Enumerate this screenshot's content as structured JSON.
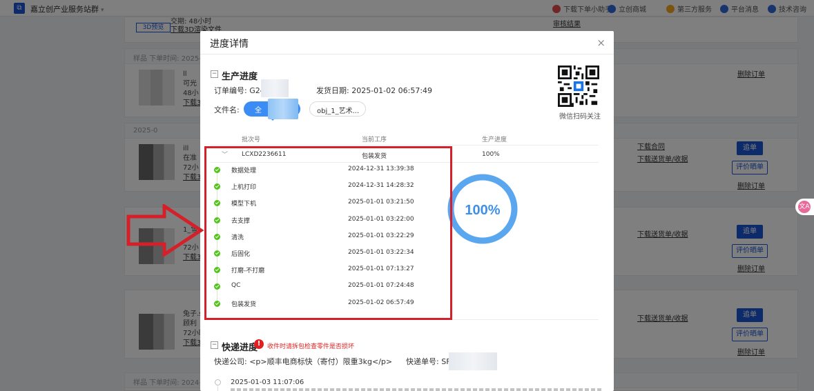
{
  "topbar": {
    "brand": "嘉立创产业服务站群",
    "nav": [
      {
        "label": "下载下单小助手",
        "color": "#e24a4a"
      },
      {
        "label": "立创商城",
        "color": "#2f6bd8"
      },
      {
        "label": "第三方服务",
        "color": "#f4a623"
      },
      {
        "label": "平台消息",
        "color": "#2f6bd8"
      },
      {
        "label": "技术咨询",
        "color": "#2f6bd8"
      }
    ]
  },
  "background": {
    "card0": {
      "time": "交期: 48小时",
      "dl": "下载3D渲染文件",
      "tag": "3D预览",
      "review": "审核结果"
    },
    "card1": {
      "head": "样品    下单时间: 2025-0",
      "t1": "ll",
      "t2": "可光",
      "t3": "48小",
      "dl": "下载3D",
      "del": "删除订单"
    },
    "card2": {
      "head": "2025-0",
      "t1": "ill",
      "t2": "在准",
      "t3": "72小",
      "dl": "下载3D",
      "link1": "下载合同",
      "link2": "下载送货单/收据",
      "btn1": "追单",
      "btn2": "评价晒单",
      "del": "删除订单"
    },
    "card3": {
      "t1": "1_雪",
      "t3": "72小",
      "dl": "下载3D",
      "link2": "下载送货单/收据",
      "btn1": "追单",
      "btn2": "评价晒单",
      "del": "删除订单"
    },
    "card4": {
      "t1": "兔子.s",
      "t2": "顾利",
      "t3": "72小时",
      "dl": "下载3D",
      "link2": "下载送货单/收据",
      "btn1": "追单",
      "btn2": "评价晒单",
      "del": "删除订单"
    },
    "card5": {
      "head": "样品    下单时间: 2024-1"
    }
  },
  "modal": {
    "title": "进度详情",
    "close": "×",
    "production": {
      "title": "生产进度",
      "order_label": "订单编号:",
      "order_value": "G24",
      "ship_label": "发货日期:",
      "ship_value": "2025-01-02 06:57:49",
      "file_label": "文件名:",
      "file_active": "全",
      "file_other": "obj_1_艺术...",
      "qr_label": "微信扫码关注",
      "columns": [
        "批次号",
        "当前工序",
        "生产进度"
      ],
      "batch": {
        "id": "LCXD2236611",
        "step": "包装发货",
        "progress": "100%"
      },
      "progress_percent": 100,
      "steps": [
        {
          "name": "数据处理",
          "time": "2024-12-31 13:39:38"
        },
        {
          "name": "上机打印",
          "time": "2024-12-31 14:28:32"
        },
        {
          "name": "模型下机",
          "time": "2025-01-01 03:21:50"
        },
        {
          "name": "去支撑",
          "time": "2025-01-01 03:22:00"
        },
        {
          "name": "清洗",
          "time": "2025-01-01 03:22:29"
        },
        {
          "name": "后固化",
          "time": "2025-01-01 03:22:34"
        },
        {
          "name": "打磨-不打磨",
          "time": "2025-01-01 07:13:27"
        },
        {
          "name": "QC",
          "time": "2025-01-01 07:24:48"
        },
        {
          "name": "包装发货",
          "time": "2025-01-02 06:57:49"
        }
      ]
    },
    "express": {
      "title": "快递进度",
      "warning": "收件时请拆包检查零件是否损坏",
      "company_label": "快递公司:",
      "company_value": "<p>顺丰电商标快（寄付）限重3kg</p>",
      "number_label": "快递单号:",
      "number_value": "SF",
      "first_time": "2025-01-03 11:07:06"
    }
  },
  "colors": {
    "accent": "#3b8cf5",
    "success": "#52c41a",
    "annotation": "#d5202a",
    "ring": "#5aa7f0"
  }
}
